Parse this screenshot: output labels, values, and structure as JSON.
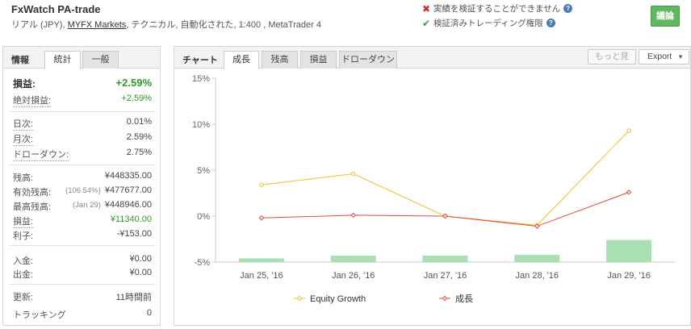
{
  "header": {
    "title": "FxWatch PA-trade",
    "sub_prefix": "リアル (JPY), ",
    "broker": "MYFX Markets",
    "sub_suffix": ", テクニカル, 自動化された, 1:400 , MetaTrader 4",
    "verify_fail": "実績を検証することができません",
    "verify_ok": "検証済みトレーディング権限",
    "help_glyph": "?",
    "discuss_label": "議論"
  },
  "left": {
    "title": "情報",
    "tabs": [
      "統計",
      "一般"
    ],
    "profit_label": "損益:",
    "profit_value": "+2.59%",
    "abs_label": "絶対損益:",
    "abs_value": "+2.59%",
    "daily_label": "日次:",
    "daily_value": "0.01%",
    "monthly_label": "月次:",
    "monthly_value": "2.59%",
    "dd_label": "ドローダウン:",
    "dd_value": "2.75%",
    "balance_label": "残高:",
    "balance_value": "¥448335.00",
    "equity_label": "有効残高:",
    "equity_note": "(106.54%)",
    "equity_value": "¥477677.00",
    "highest_label": "最高残高:",
    "highest_note": "(Jan 29)",
    "highest_value": "¥448946.00",
    "pl_label": "損益:",
    "pl_value": "¥11340.00",
    "interest_label": "利子:",
    "interest_value": "-¥153.00",
    "deposit_label": "入金:",
    "deposit_value": "¥0.00",
    "withdraw_label": "出金:",
    "withdraw_value": "¥0.00",
    "updated_label": "更新:",
    "updated_value": "11時間前",
    "tracking_label": "トラッキング",
    "tracking_value": "0"
  },
  "chart_panel": {
    "title": "チャート",
    "tabs": [
      "成長",
      "残高",
      "損益",
      "ドローダウン"
    ],
    "more_label": "もっと見",
    "export_label": "Export",
    "caret": "▼"
  },
  "chart_data": {
    "type": "line",
    "categories": [
      "Jan 25, '16",
      "Jan 26, '16",
      "Jan 27, '16",
      "Jan 28, '16",
      "Jan 29, '16"
    ],
    "yticks": [
      "15%",
      "10%",
      "5%",
      "0%",
      "-5%"
    ],
    "ylim": [
      -5,
      15
    ],
    "grid": false,
    "legend_position": "bottom",
    "series": [
      {
        "name": "Equity Growth",
        "type": "line",
        "color": "#f0c020",
        "values": [
          3.4,
          4.6,
          0.0,
          -1.0,
          9.3
        ]
      },
      {
        "name": "成長",
        "type": "line",
        "color": "#e04a3a",
        "values": [
          -0.2,
          0.1,
          0.0,
          -1.1,
          2.6
        ]
      },
      {
        "name": "",
        "type": "bar",
        "color": "#a9dfb2",
        "values": [
          -4.6,
          -4.3,
          -4.3,
          -4.2,
          -2.6
        ]
      }
    ]
  },
  "colors": {
    "accent_green": "#2e9a2e",
    "button_green": "#5fb760",
    "error_red": "#cc2b2b"
  }
}
